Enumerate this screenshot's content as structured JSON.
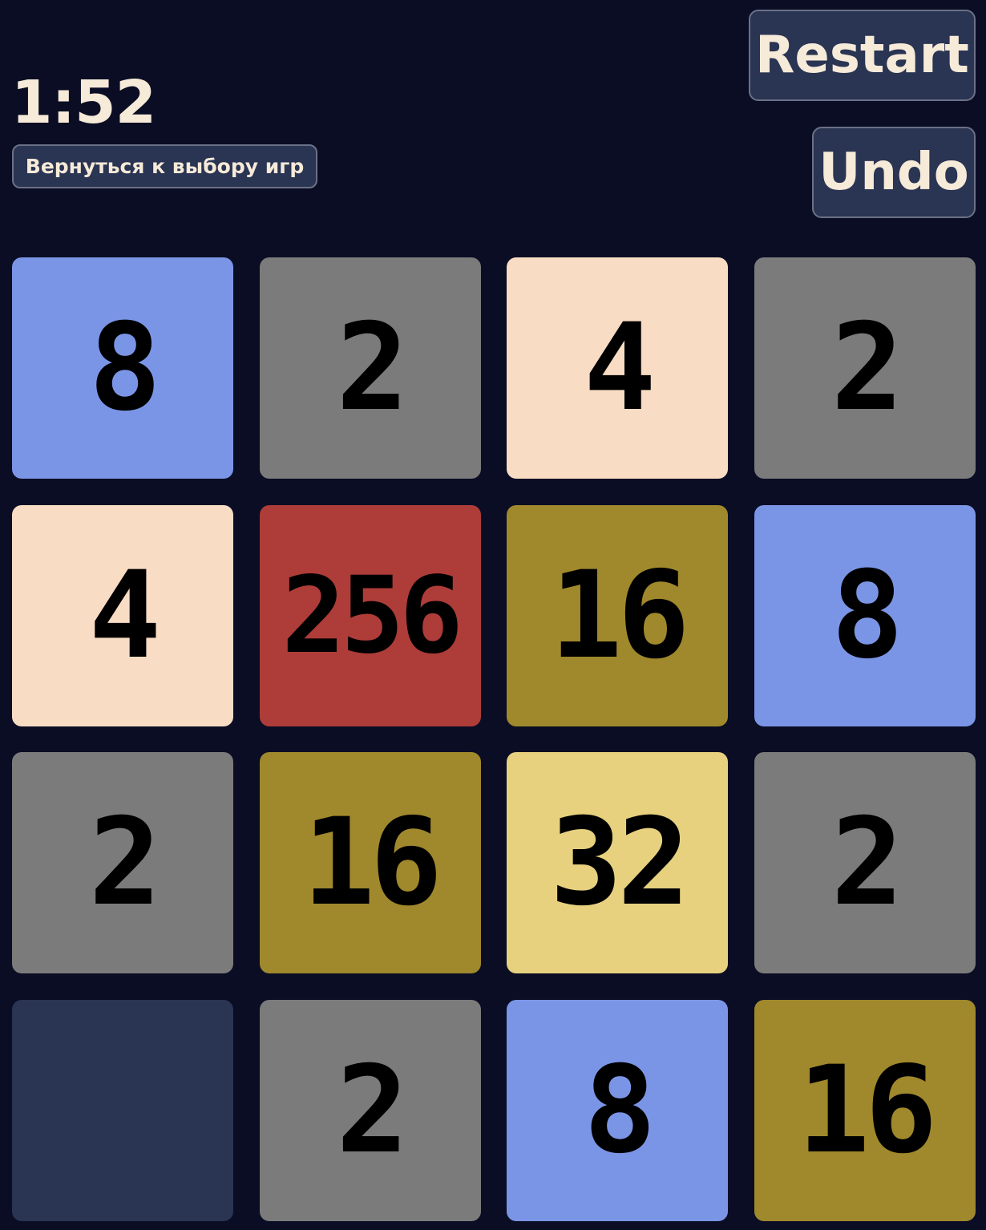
{
  "header": {
    "timer": "1:52",
    "back_label": "Вернуться к выбору игр",
    "restart_label": "Restart",
    "undo_label": "Undo"
  },
  "colors": {
    "background": "#0a0d24",
    "button_bg": "#2a3453",
    "button_border": "#6b7186",
    "text_light": "#f6ead8",
    "empty": "#2a3453",
    "2": "#7b7b7b",
    "4": "#f9dcc4",
    "8": "#7b95e6",
    "16": "#a0882c",
    "32": "#e7d17f",
    "256": "#ae3c38"
  },
  "board": {
    "rows": [
      [
        8,
        2,
        4,
        2
      ],
      [
        4,
        256,
        16,
        8
      ],
      [
        2,
        16,
        32,
        2
      ],
      [
        null,
        2,
        8,
        16
      ]
    ]
  }
}
